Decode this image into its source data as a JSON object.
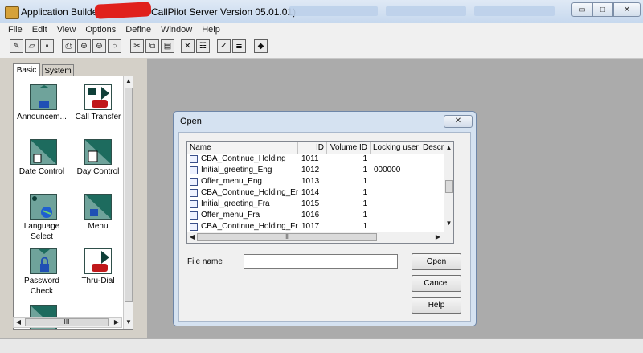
{
  "window": {
    "title": "Application Builder -",
    "server_version": "CallPilot Server Version 05.01.01)",
    "controls": {
      "minimize": "▭",
      "maximize": "□",
      "close": "✕"
    }
  },
  "menu": [
    "File",
    "Edit",
    "View",
    "Options",
    "Define",
    "Window",
    "Help"
  ],
  "toolbar_icons": [
    "new-icon",
    "open-icon",
    "save-icon",
    "print-icon",
    "zoom-in-icon",
    "zoom-out-icon",
    "zoom-icon",
    "cut-icon",
    "copy-icon",
    "paste-icon",
    "delete-icon",
    "properties-icon",
    "validate-icon",
    "compile-icon",
    "book-icon"
  ],
  "palette": {
    "tabs": [
      "Basic",
      "System"
    ],
    "blocks": [
      {
        "label": "Announcem..."
      },
      {
        "label": "Call Transfer"
      },
      {
        "label": "Date Control"
      },
      {
        "label": "Day Control"
      },
      {
        "label": "Language Select"
      },
      {
        "label": "Menu"
      },
      {
        "label": "Password Check"
      },
      {
        "label": "Thru-Dial"
      }
    ],
    "scroll_thumb_text": "III"
  },
  "dialog": {
    "title": "Open",
    "columns": [
      "Name",
      "ID",
      "Volume ID",
      "Locking user",
      "Descrip"
    ],
    "rows": [
      {
        "name": "CBA_Continue_Holding",
        "id": "1011",
        "volume": "1",
        "locking": ""
      },
      {
        "name": "Initial_greeting_Eng",
        "id": "1012",
        "volume": "1",
        "locking": "000000"
      },
      {
        "name": "Offer_menu_Eng",
        "id": "1013",
        "volume": "1",
        "locking": ""
      },
      {
        "name": "CBA_Continue_Holding_Eng",
        "id": "1014",
        "volume": "1",
        "locking": ""
      },
      {
        "name": "Initial_greeting_Fra",
        "id": "1015",
        "volume": "1",
        "locking": ""
      },
      {
        "name": "Offer_menu_Fra",
        "id": "1016",
        "volume": "1",
        "locking": ""
      },
      {
        "name": "CBA_Continue_Holding_Fra",
        "id": "1017",
        "volume": "1",
        "locking": ""
      }
    ],
    "scroll_thumb_text": "III",
    "file_name_label": "File name",
    "file_name_value": "",
    "buttons": {
      "open": "Open",
      "cancel": "Cancel",
      "help": "Help"
    }
  }
}
